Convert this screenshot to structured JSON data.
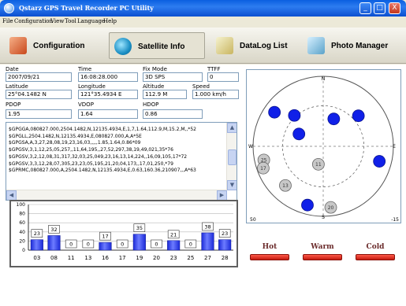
{
  "window": {
    "title": "Qstarz GPS Travel Recorder PC Utility",
    "minimize_glyph": "_",
    "maximize_glyph": "□",
    "close_glyph": "X"
  },
  "menu": [
    "File",
    "Configuration",
    "View",
    "Tool",
    "Language",
    "Help"
  ],
  "toolbar": {
    "configuration": "Configuration",
    "satellite_info": "Satellite Info",
    "datalog_list": "DataLog List",
    "photo_manager": "Photo Manager"
  },
  "fields": {
    "date_label": "Date",
    "date": "2007/09/21",
    "time_label": "Time",
    "time": "16:08:28.000",
    "fixmode_label": "Fix Mode",
    "fixmode": "3D SPS",
    "ttff_label": "TTFF",
    "ttff": "0",
    "latitude_label": "Latitude",
    "latitude": "25°04.1482 N",
    "longitude_label": "Longitude",
    "longitude": "121°35.4934 E",
    "altitude_label": "Altitude",
    "altitude": "112.9 M",
    "speed_label": "Speed",
    "speed": "1.000 km/h",
    "pdop_label": "PDOP",
    "pdop": "1.95",
    "vdop_label": "VDOP",
    "vdop": "1.64",
    "hdop_label": "HDOP",
    "hdop": "0.86"
  },
  "nmea": [
    "$GPGGA,080827.000,2504.1482,N,12135.4934,E,1,7,1.64,112.9,M,15.2,M,,*52",
    "$GPGLL,2504.1482,N,12135.4934,E,080827.000,A,A*5E",
    "$GPGSA,A,3,27,28,08,19,23,16,03,,,,,1.85,1.64,0.86*09",
    "$GPGSV,3,1,12,25,05,257,,11,64,195,,27,52,297,38,19,49,021,35*76",
    "$GPGSV,3,2,12,08,31,317,32,03,25,049,23,16,13,14,224,,16,09,105,17*72",
    "$GPGSV,3,3,12,28,07,305,23,23,05,195,21,20,04,173,,17,01,250,*79",
    "$GPRMC,080827.000,A,2504.1482,N,12135.4934,E,0.63,160.36,210907,,,A*63"
  ],
  "scroll": {
    "up": "▲",
    "down": "▼",
    "left": "◀",
    "right": "▶"
  },
  "signal_chart": {
    "y_ticks": [
      "100",
      "80",
      "60",
      "40",
      "20",
      "0"
    ],
    "bars": [
      {
        "prn": "03",
        "snr": 23
      },
      {
        "prn": "08",
        "snr": 32
      },
      {
        "prn": "11",
        "snr": 0
      },
      {
        "prn": "13",
        "snr": 0
      },
      {
        "prn": "16",
        "snr": 17
      },
      {
        "prn": "17",
        "snr": 0
      },
      {
        "prn": "19",
        "snr": 35
      },
      {
        "prn": "20",
        "snr": 0
      },
      {
        "prn": "23",
        "snr": 21
      },
      {
        "prn": "25",
        "snr": 0
      },
      {
        "prn": "27",
        "snr": 38
      },
      {
        "prn": "28",
        "snr": 23
      }
    ],
    "colors": {
      "bar": "#1b2ad8",
      "bar_light": "#6d7cff",
      "grid": "#b8b8b8",
      "label_box": "#ffffff"
    }
  },
  "sky_view": {
    "labels": {
      "n": "N",
      "s": "S",
      "e": "E",
      "w": "W",
      "corner_bl": "50",
      "corner_br": "-15"
    },
    "satellites": [
      {
        "prn": "",
        "az": 297,
        "el": 52,
        "used": true
      },
      {
        "prn": "",
        "az": 21,
        "el": 49,
        "used": true
      },
      {
        "prn": "",
        "az": 317,
        "el": 31,
        "used": true
      },
      {
        "prn": "",
        "az": 49,
        "el": 25,
        "used": true
      },
      {
        "prn": "",
        "az": 105,
        "el": 9,
        "used": true
      },
      {
        "prn": "",
        "az": 195,
        "el": 5,
        "used": true
      },
      {
        "prn": "",
        "az": 305,
        "el": 7,
        "used": true
      },
      {
        "prn": "25",
        "az": 257,
        "el": 5,
        "used": false
      },
      {
        "prn": "11",
        "az": 195,
        "el": 64,
        "used": false
      },
      {
        "prn": "17",
        "az": 250,
        "el": 1,
        "used": false
      },
      {
        "prn": "13",
        "az": 224,
        "el": 14,
        "used": false
      },
      {
        "prn": "20",
        "az": 173,
        "el": 4,
        "used": false
      }
    ],
    "colors": {
      "used": "#1020e8",
      "unused": "#c8c8c8"
    }
  },
  "buttons": {
    "hot": "Hot",
    "warm": "Warm",
    "cold": "Cold"
  }
}
